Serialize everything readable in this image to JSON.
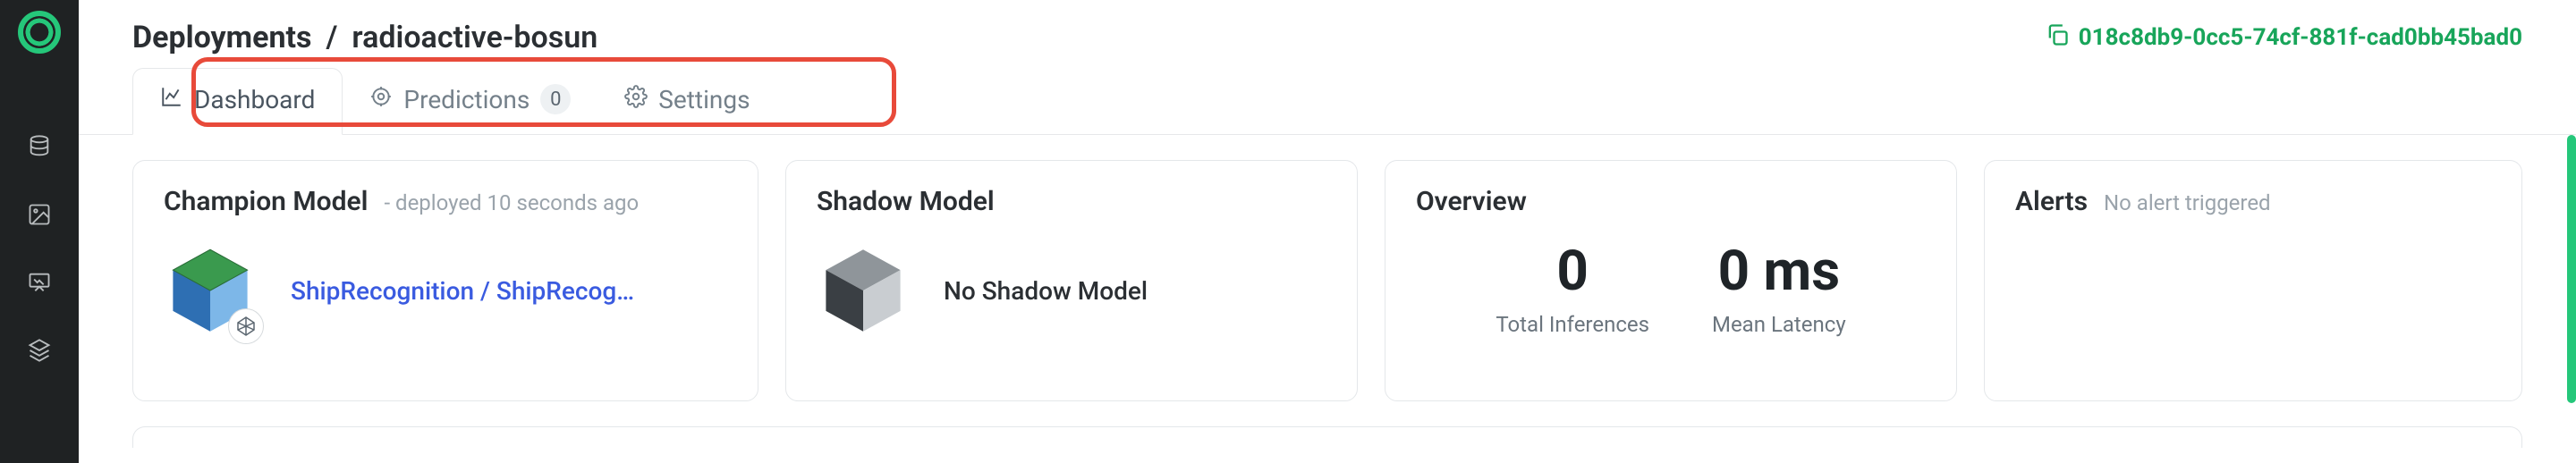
{
  "breadcrumb": {
    "root": "Deployments",
    "sep": "/",
    "name": "radioactive-bosun"
  },
  "deployment_id": "018c8db9-0cc5-74cf-881f-cad0bb45bad0",
  "tabs": {
    "dashboard": "Dashboard",
    "predictions": "Predictions",
    "predictions_badge": "0",
    "settings": "Settings"
  },
  "champion": {
    "title": "Champion Model",
    "subtitle": "- deployed 10 seconds ago",
    "link": "ShipRecognition / ShipRecog…"
  },
  "shadow": {
    "title": "Shadow Model",
    "none": "No Shadow Model"
  },
  "overview": {
    "title": "Overview",
    "total_value": "0",
    "total_label": "Total Inferences",
    "latency_value": "0 ms",
    "latency_label": "Mean Latency"
  },
  "alerts": {
    "title": "Alerts",
    "none": "No alert triggered"
  }
}
